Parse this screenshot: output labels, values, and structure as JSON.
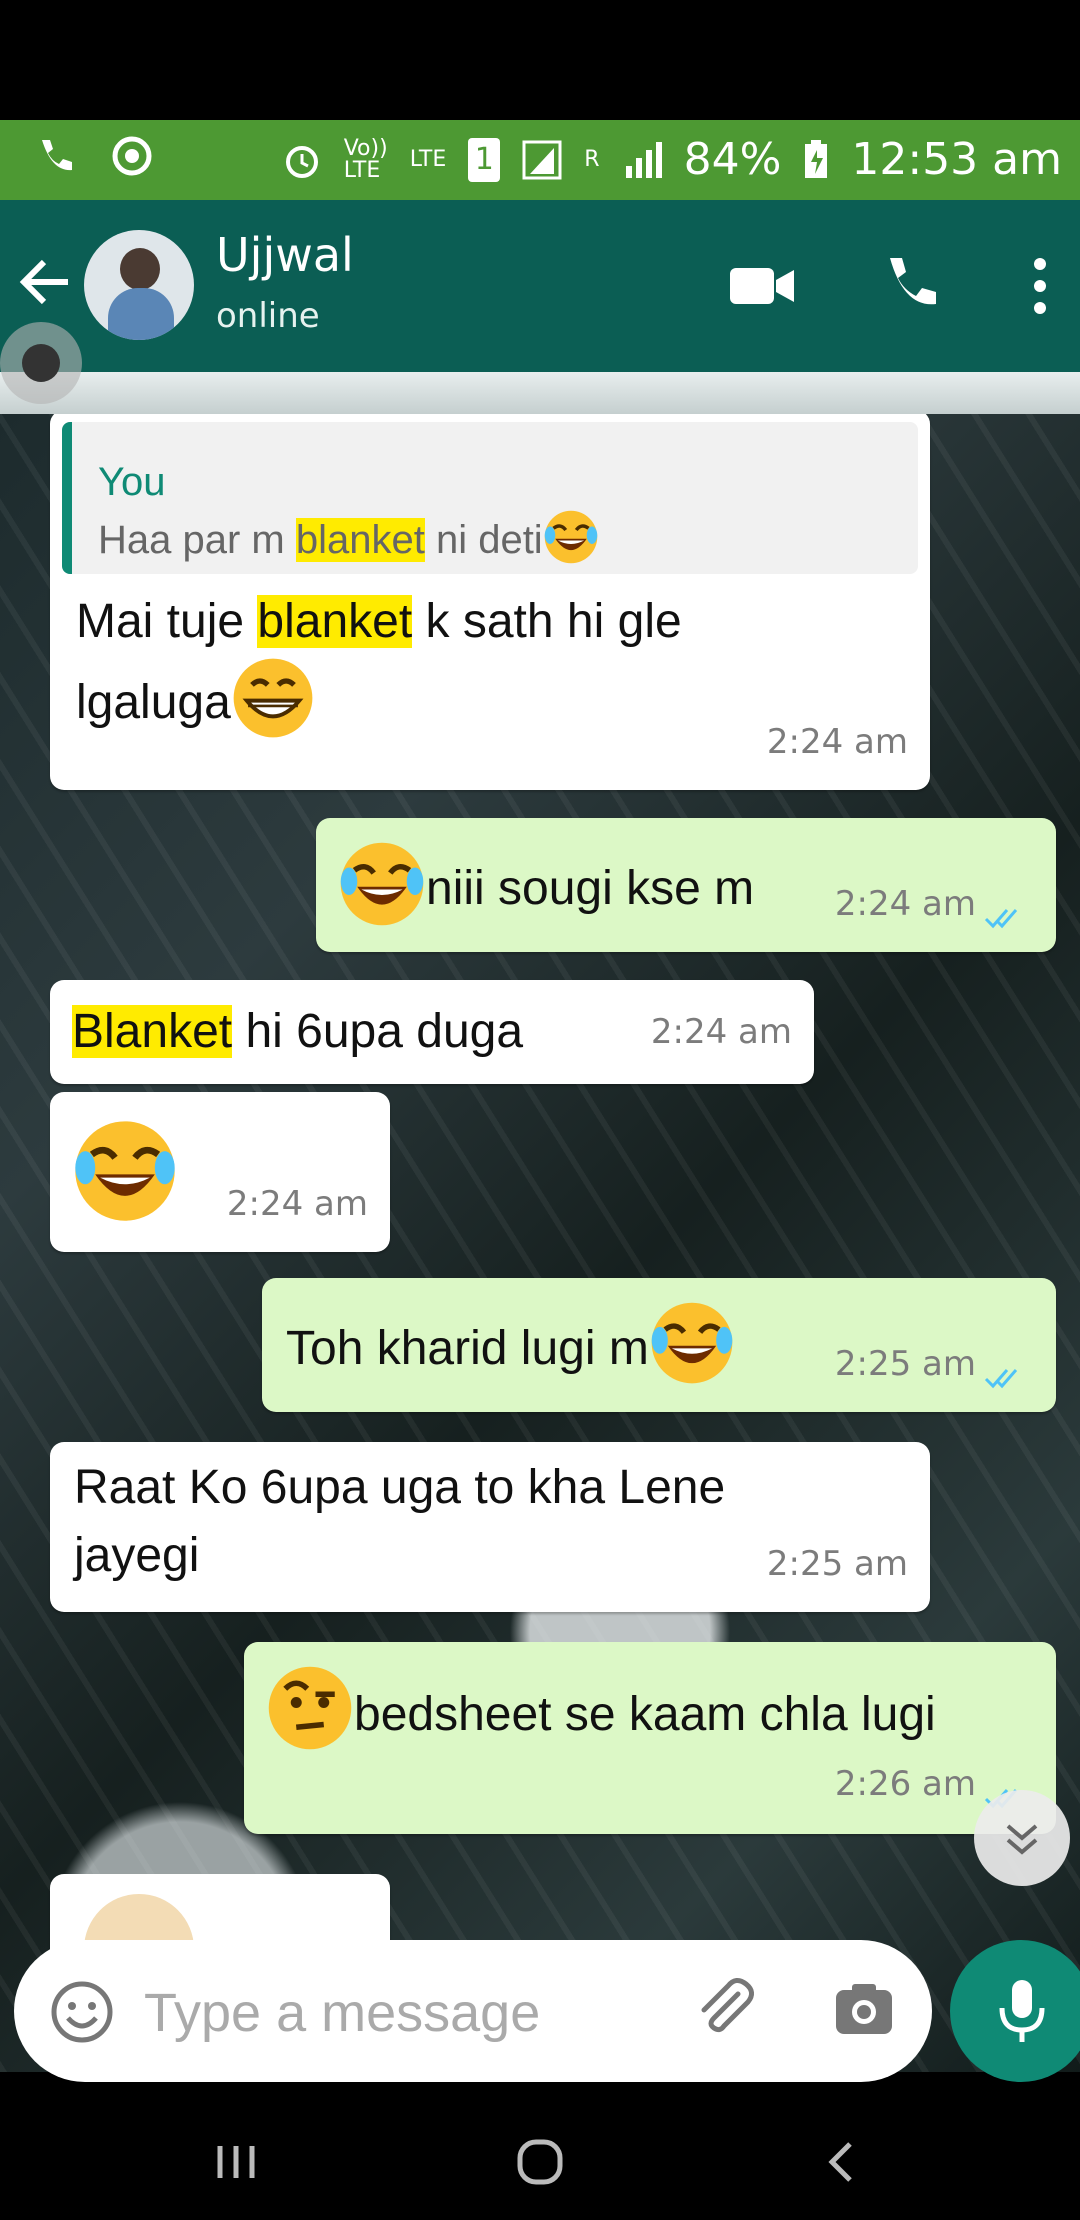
{
  "status_bar": {
    "volte": "Vo)) LTE",
    "lte": "LTE",
    "sim": "1",
    "roaming": "R",
    "battery": "84%",
    "time": "12:53 am"
  },
  "header": {
    "contact_name": "Ujjwal",
    "contact_status": "online"
  },
  "messages": [
    {
      "dir": "in",
      "quote_author": "You",
      "quote_pre": "Haa par m ",
      "quote_highlight": "blanket",
      "quote_post": " ni deti",
      "line1_pre": "Mai tuje ",
      "line1_highlight": "blanket",
      "line1_post": " k sath hi gle",
      "line2": "lgaluga",
      "time": "2:24 am"
    },
    {
      "dir": "out",
      "text": "niii sougi kse m",
      "time": "2:24 am"
    },
    {
      "dir": "in",
      "highlight": "Blanket",
      "text": " hi 6upa duga",
      "time": "2:24 am"
    },
    {
      "dir": "in",
      "text": "",
      "time": "2:24 am"
    },
    {
      "dir": "out",
      "text": "Toh kharid lugi m",
      "time": "2:25 am"
    },
    {
      "dir": "in",
      "line1": "Raat Ko 6upa uga to kha Lene",
      "line2": "jayegi",
      "time": "2:25 am"
    },
    {
      "dir": "out",
      "text": "bedsheet se kaam chla lugi",
      "time": "2:26 am"
    }
  ],
  "input": {
    "placeholder": "Type a message"
  },
  "colors": {
    "header": "#0b5e54",
    "status": "#4d9933",
    "outgoing": "#dcf8c6",
    "incoming": "#ffffff",
    "accent": "#0f8a75",
    "highlight": "#ffeb00"
  },
  "icons": [
    "phone-icon",
    "camera-shutter-icon",
    "alarm-icon",
    "signal-icon",
    "battery-icon",
    "back-arrow-icon",
    "video-call-icon",
    "voice-call-icon",
    "more-vert-icon",
    "emoji-icon",
    "attach-icon",
    "camera-icon",
    "mic-icon",
    "recent-apps-icon",
    "home-icon",
    "back-nav-icon",
    "chevron-down-icon"
  ]
}
